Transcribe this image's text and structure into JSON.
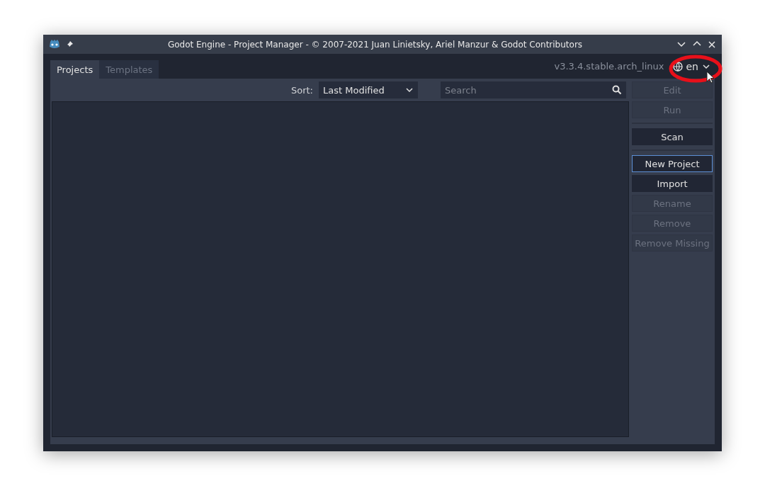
{
  "window": {
    "title": "Godot Engine - Project Manager - © 2007-2021 Juan Linietsky, Ariel Manzur & Godot Contributors"
  },
  "tabs": [
    {
      "label": "Projects",
      "selected": true
    },
    {
      "label": "Templates",
      "selected": false
    }
  ],
  "version": "v3.3.4.stable.arch_linux",
  "language": {
    "value": "en",
    "highlighted": true
  },
  "sort": {
    "label": "Sort:",
    "value": "Last Modified"
  },
  "search": {
    "placeholder": "Search"
  },
  "sidebar": {
    "groups": [
      {
        "buttons": [
          {
            "label": "Edit",
            "disabled": true,
            "focused": false
          },
          {
            "label": "Run",
            "disabled": true,
            "focused": false
          }
        ]
      },
      {
        "buttons": [
          {
            "label": "Scan",
            "disabled": false,
            "focused": false
          }
        ]
      },
      {
        "buttons": [
          {
            "label": "New Project",
            "disabled": false,
            "focused": true
          },
          {
            "label": "Import",
            "disabled": false,
            "focused": false
          },
          {
            "label": "Rename",
            "disabled": true,
            "focused": false
          },
          {
            "label": "Remove",
            "disabled": true,
            "focused": false
          },
          {
            "label": "Remove Missing",
            "disabled": true,
            "focused": false
          }
        ]
      }
    ]
  }
}
